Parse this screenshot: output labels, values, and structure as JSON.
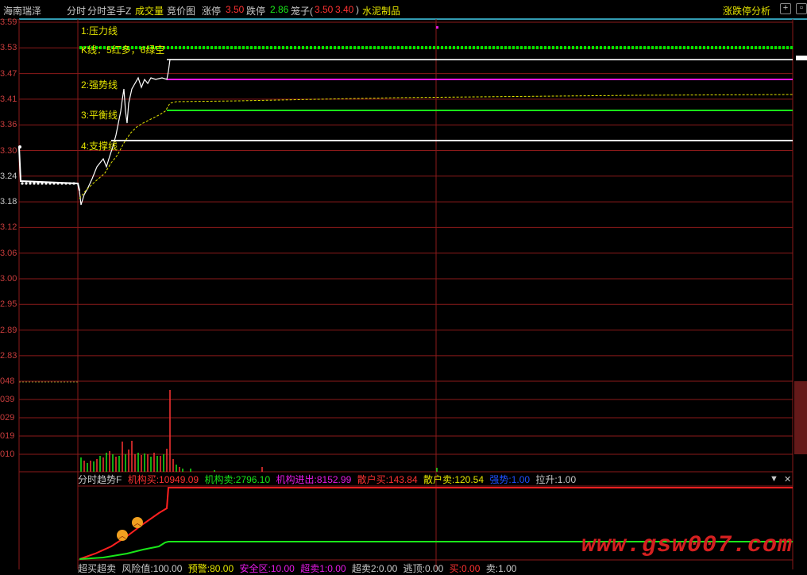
{
  "topbar": {
    "stock_name": "海南瑞泽",
    "tabs": [
      "分时",
      "分时圣手Z",
      "成交量",
      "竞价图"
    ],
    "limit_up_label": "涨停",
    "limit_up_value": "3.50",
    "limit_down_label": "跌停",
    "limit_down_value": "2.86",
    "cage_label": "笼子(",
    "cage_up": "3.50",
    "cage_down": "3.40",
    "cage_close": ")",
    "sector": "水泥制品",
    "analysis_label": "涨跌停分析"
  },
  "price_axis": [
    "3.59",
    "3.53",
    "3.47",
    "3.41",
    "3.36",
    "3.30",
    "3.24",
    "3.18",
    "3.12",
    "3.06",
    "3.00",
    "2.95",
    "2.89",
    "2.83"
  ],
  "volume_axis": [
    "048",
    "039",
    "029",
    "019",
    "010"
  ],
  "lines": {
    "pressure": "1:压力线",
    "kline_note": "K线：5红多，6绿空",
    "strong": "2:强势线",
    "balance": "3:平衡线",
    "support": "4:支撑线"
  },
  "indicator": {
    "title": "分时趋势F",
    "inst_buy_label": "机构买:",
    "inst_buy": "10949.09",
    "inst_sell_label": "机构卖:",
    "inst_sell": "2796.10",
    "inst_net_label": "机构进出:",
    "inst_net": "8152.99",
    "retail_buy_label": "散户买:",
    "retail_buy": "143.84",
    "retail_sell_label": "散户卖:",
    "retail_sell": "120.54",
    "strong_label": "强势:",
    "strong": "1.00",
    "pull_label": "拉升:",
    "pull": "1.00"
  },
  "bottom_indicator": {
    "title": "超买超卖",
    "risk_label": "风险值:",
    "risk": "100.00",
    "warn_label": "预警:",
    "warn": "80.00",
    "safe_label": "安全区:",
    "safe": "10.00",
    "oversold1_label": "超卖1:",
    "oversold1": "0.00",
    "oversold2_label": "超卖2:",
    "oversold2": "0.00",
    "escape_label": "逃顶:",
    "escape": "0.00",
    "buy_label": "买:",
    "buy": "0.00",
    "sell_label": "卖:",
    "sell": "1.00"
  },
  "watermark": "www.gsw007.com",
  "colors": {
    "grid": "#8b1a1a",
    "price": "#ffffff",
    "avg": "#e6e600",
    "pressure": "#00e600",
    "strong": "#e619e6",
    "balance": "#19e619",
    "support": "#ffffff",
    "inst_buy": "#ff3232",
    "inst_sell": "#19e619",
    "inst_net": "#e619e6",
    "retail_buy": "#ff3232",
    "retail_sell": "#e6e600",
    "strong_ind": "#1e50ff"
  }
}
